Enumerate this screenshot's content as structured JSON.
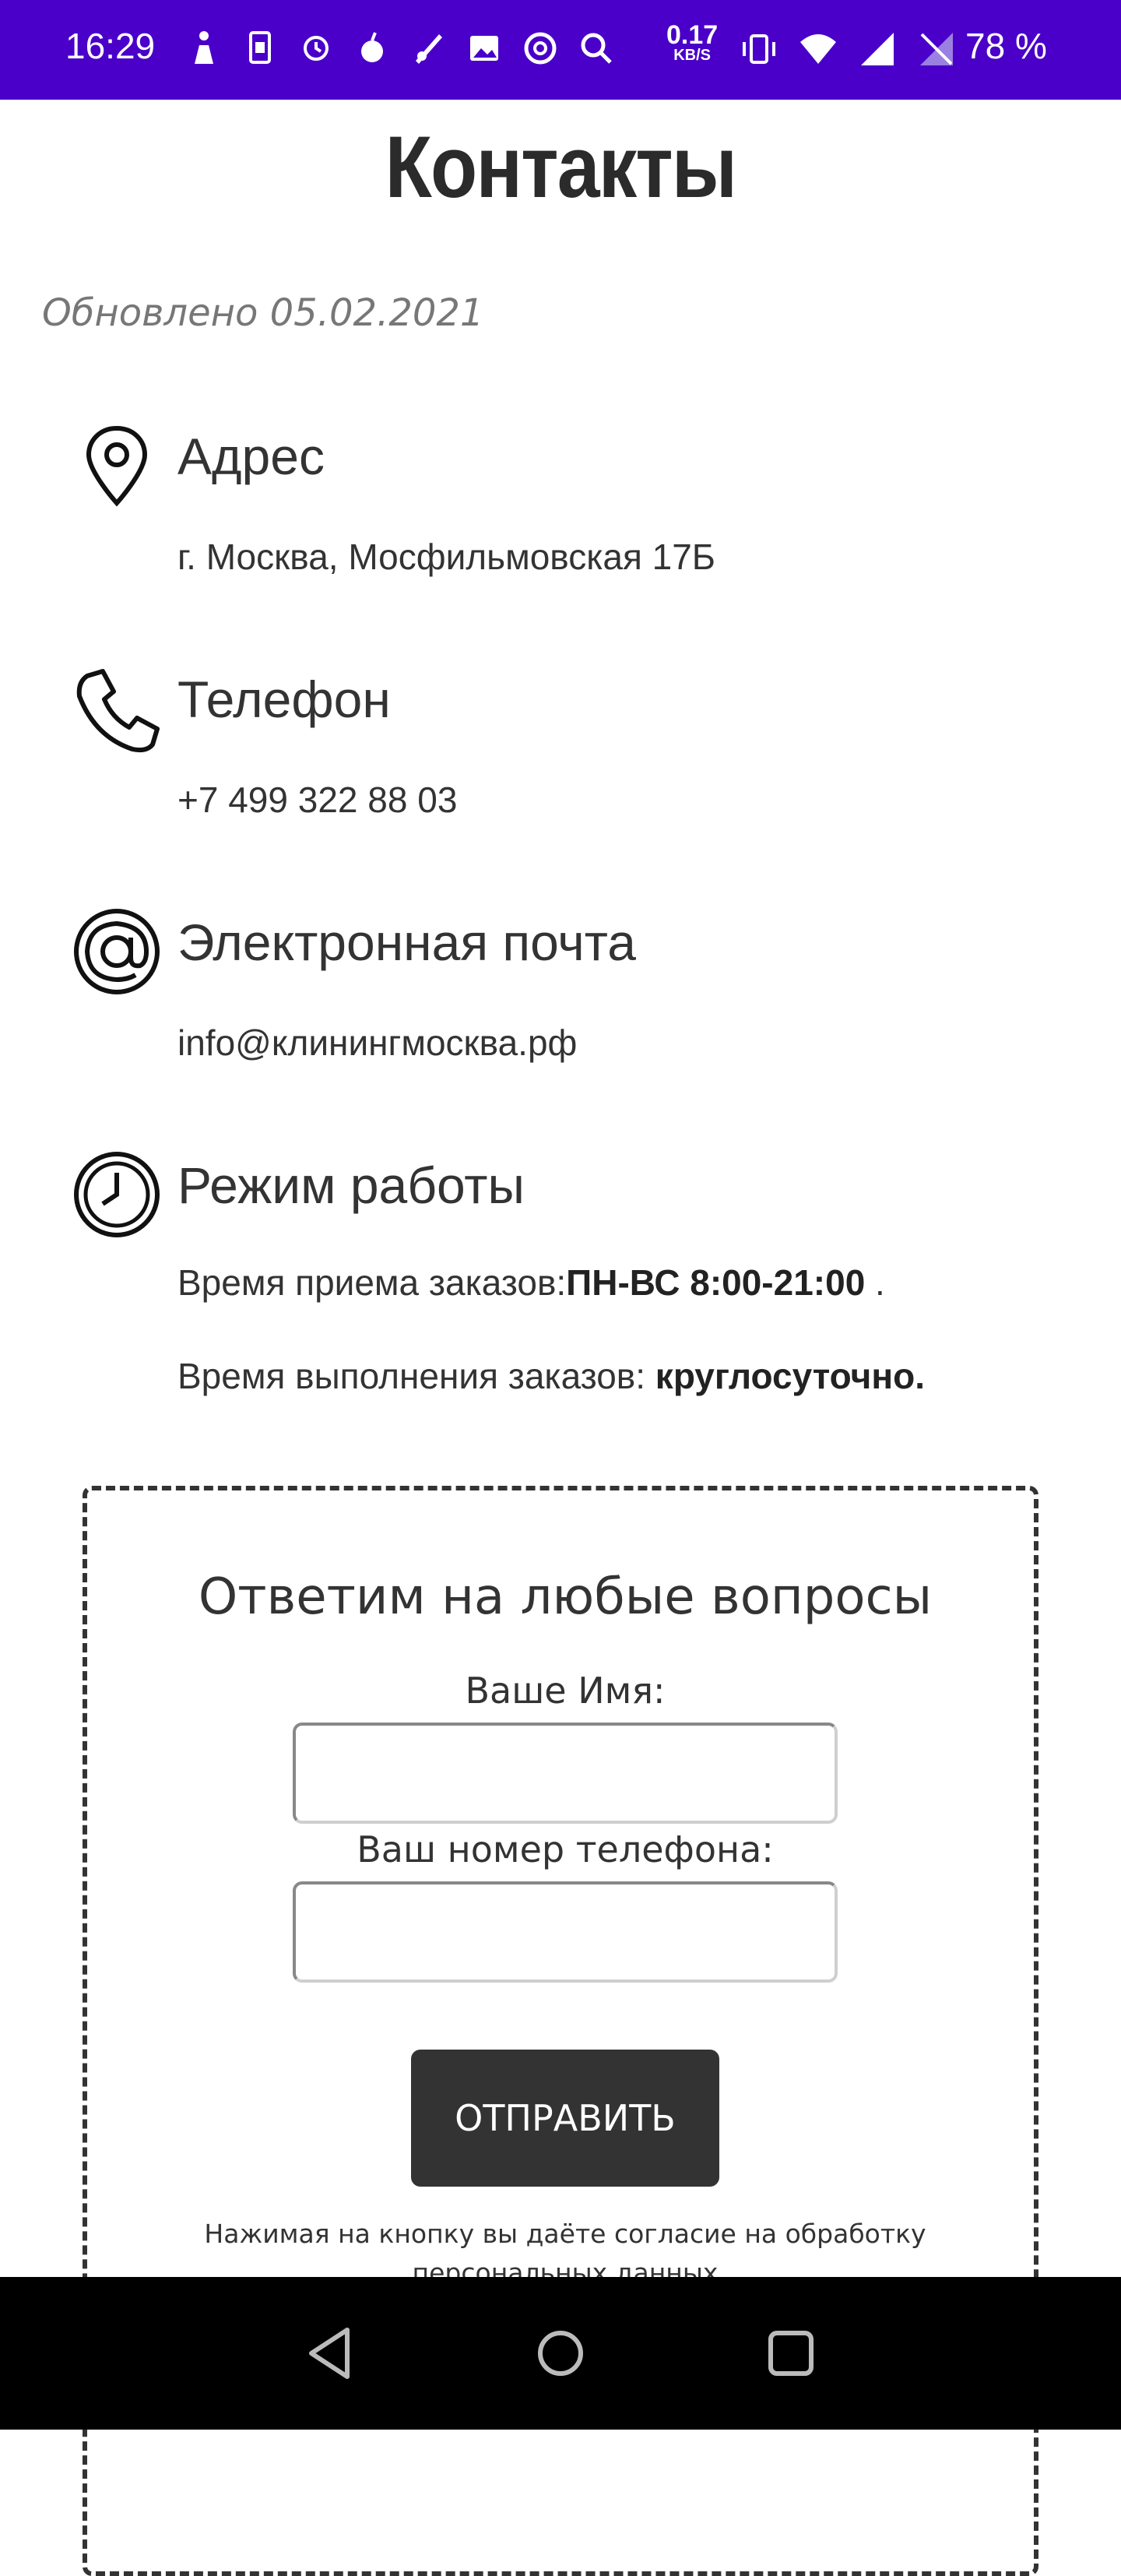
{
  "status_bar": {
    "time": "16:29",
    "speed_value": "0.17",
    "speed_unit": "KB/S",
    "battery": "78 %",
    "icons": [
      "figure-icon",
      "sim-icon",
      "watch-icon",
      "fruit-icon",
      "rocket-icon",
      "image-icon",
      "at-icon",
      "search-icon",
      "vibrate-icon",
      "wifi-icon",
      "signal-icon",
      "no-signal-icon"
    ]
  },
  "page": {
    "title": "Контакты",
    "updated": "Обновлено 05.02.2021"
  },
  "sections": {
    "address": {
      "title": "Адрес",
      "text": "г. Москва, Мосфильмовская 17Б"
    },
    "phone": {
      "title": "Телефон",
      "text": "+7 499 322 88 03"
    },
    "email": {
      "title": "Электронная почта",
      "text": "info@клинингмосква.рф"
    },
    "hours": {
      "title": "Режим работы",
      "line1_label": "Время приема заказов:",
      "line1_value": "ПН-ВС 8:00-21:00",
      "line1_suffix": " .",
      "line2_label": "Время выполнения заказов: ",
      "line2_value": "круглосуточно."
    }
  },
  "form": {
    "title": "Ответим на любые вопросы",
    "name_label": "Ваше Имя:",
    "name_value": "",
    "phone_label": "Ваш номер телефона:",
    "phone_value": "",
    "submit_label": "ОТПРАВИТЬ",
    "consent": "Нажимая на кнопку вы даёте согласие на обработку персональных данных"
  },
  "nav": {
    "icons": [
      "back-icon",
      "home-icon",
      "recents-icon"
    ]
  },
  "colors": {
    "status_bar": "#4a00c8",
    "text": "#333333",
    "button": "#333333",
    "nav_bar": "#000000"
  }
}
